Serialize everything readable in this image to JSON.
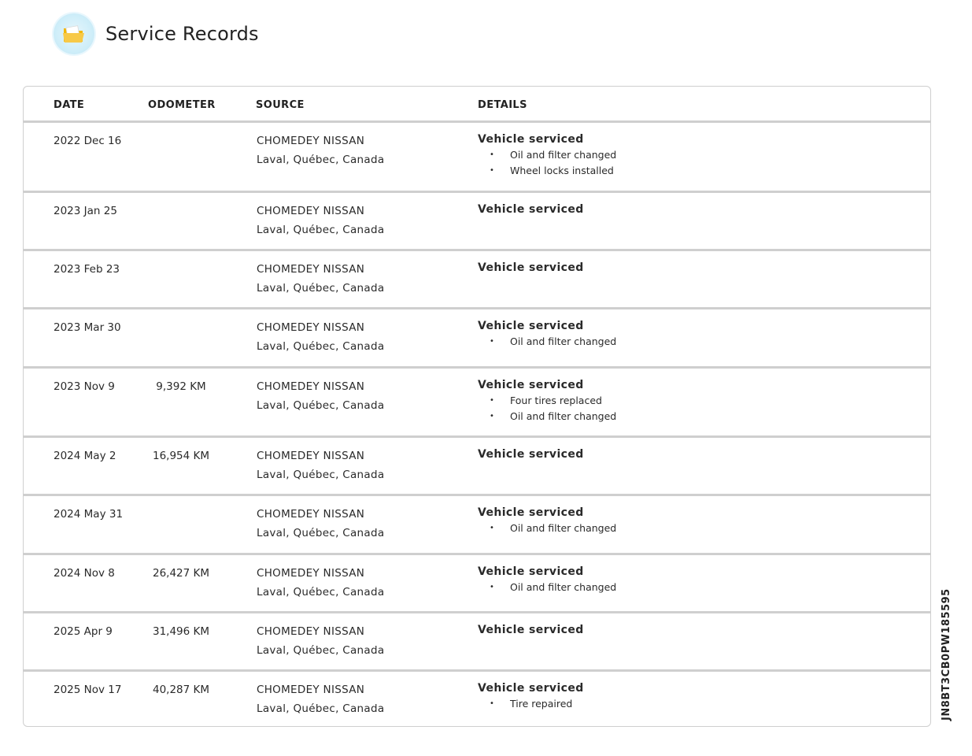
{
  "header": {
    "title": "Service Records",
    "icon": "folder-icon",
    "badge_color": "#cfeef9",
    "folder_color": "#f7c948"
  },
  "table": {
    "columns": [
      "DATE",
      "ODOMETER",
      "SOURCE",
      "DETAILS"
    ],
    "rows": [
      {
        "date": "2022 Dec 16",
        "odometer": "",
        "source_name": "CHOMEDEY NISSAN",
        "source_location": "Laval, Québec, Canada",
        "title": "Vehicle serviced",
        "items": [
          "Oil and filter changed",
          "Wheel locks installed"
        ]
      },
      {
        "date": "2023 Jan 25",
        "odometer": "",
        "source_name": "CHOMEDEY NISSAN",
        "source_location": "Laval, Québec, Canada",
        "title": "Vehicle serviced",
        "items": []
      },
      {
        "date": "2023 Feb 23",
        "odometer": "",
        "source_name": "CHOMEDEY NISSAN",
        "source_location": "Laval, Québec, Canada",
        "title": "Vehicle serviced",
        "items": []
      },
      {
        "date": "2023 Mar 30",
        "odometer": "",
        "source_name": "CHOMEDEY NISSAN",
        "source_location": "Laval, Québec, Canada",
        "title": "Vehicle serviced",
        "items": [
          "Oil and filter changed"
        ]
      },
      {
        "date": "2023 Nov 9",
        "odometer": "9,392 KM",
        "source_name": "CHOMEDEY NISSAN",
        "source_location": "Laval, Québec, Canada",
        "title": "Vehicle serviced",
        "items": [
          "Four tires replaced",
          "Oil and filter changed"
        ]
      },
      {
        "date": "2024 May 2",
        "odometer": "16,954 KM",
        "source_name": "CHOMEDEY NISSAN",
        "source_location": "Laval, Québec, Canada",
        "title": "Vehicle serviced",
        "items": []
      },
      {
        "date": "2024 May 31",
        "odometer": "",
        "source_name": "CHOMEDEY NISSAN",
        "source_location": "Laval, Québec, Canada",
        "title": "Vehicle serviced",
        "items": [
          "Oil and filter changed"
        ]
      },
      {
        "date": "2024 Nov 8",
        "odometer": "26,427 KM",
        "source_name": "CHOMEDEY NISSAN",
        "source_location": "Laval, Québec, Canada",
        "title": "Vehicle serviced",
        "items": [
          "Oil and filter changed"
        ]
      },
      {
        "date": "2025 Apr 9",
        "odometer": "31,496 KM",
        "source_name": "CHOMEDEY NISSAN",
        "source_location": "Laval, Québec, Canada",
        "title": "Vehicle serviced",
        "items": []
      },
      {
        "date": "2025 Nov 17",
        "odometer": "40,287 KM",
        "source_name": "CHOMEDEY NISSAN",
        "source_location": "Laval, Québec, Canada",
        "title": "Vehicle serviced",
        "items": [
          "Tire repaired"
        ]
      }
    ]
  },
  "vin": "JN8BT3CB0PW185595"
}
